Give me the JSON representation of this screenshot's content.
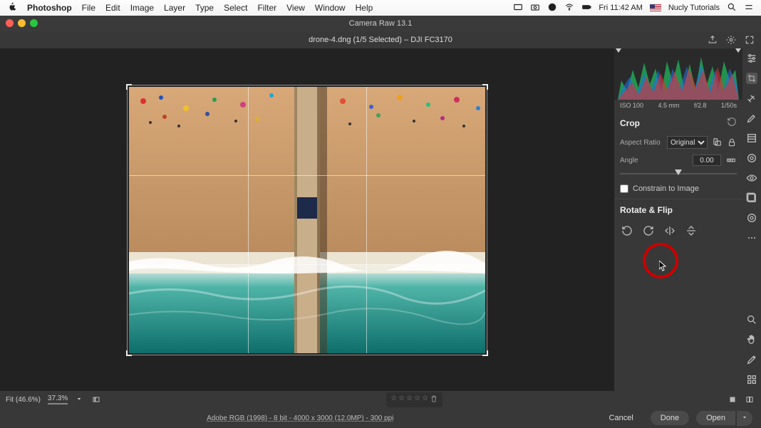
{
  "menubar": {
    "app": "Photoshop",
    "items": [
      "File",
      "Edit",
      "Image",
      "Layer",
      "Type",
      "Select",
      "Filter",
      "View",
      "Window",
      "Help"
    ],
    "right": {
      "time": "Fri 11:42 AM",
      "user": "Nucly Tutorials"
    }
  },
  "window": {
    "title": "Camera Raw 13.1"
  },
  "document": {
    "title": "drone-4.dng (1/5 Selected)  –  DJI FC3170"
  },
  "metadata": {
    "iso": "ISO 100",
    "focal": "4.5 mm",
    "aperture": "f/2.8",
    "shutter": "1/50s"
  },
  "panel": {
    "crop": {
      "title": "Crop",
      "aspect_label": "Aspect Ratio",
      "aspect_value": "Original",
      "angle_label": "Angle",
      "angle_value": "0.00",
      "constrain_label": "Constrain to Image"
    },
    "rotate": {
      "title": "Rotate & Flip"
    }
  },
  "statusbar": {
    "fit": "Fit (46.6%)",
    "zoom": "37.3%"
  },
  "bottombar": {
    "meta": "Adobe RGB (1998) - 8 bit - 4000 x 3000 (12.0MP) - 300 ppi",
    "cancel": "Cancel",
    "done": "Done",
    "open": "Open"
  }
}
